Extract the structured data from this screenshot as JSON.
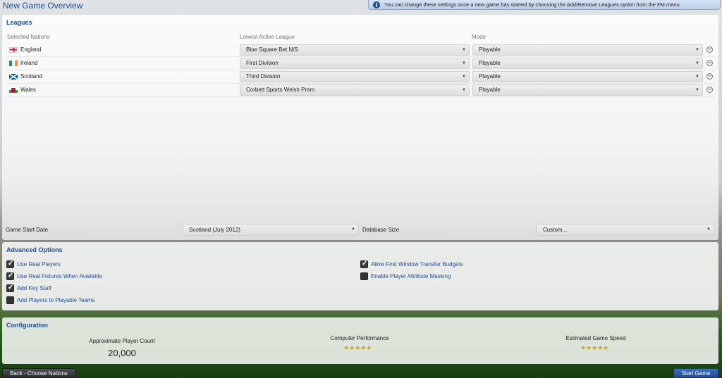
{
  "header": {
    "title": "New Game Overview",
    "info": "You can change these settings once a new game has started by choosing the Add/Remove Leagues option from the FM menu."
  },
  "leagues": {
    "title": "Leagues",
    "columns": {
      "nations": "Selected Nations",
      "league": "Lowest Active League",
      "mode": "Mode"
    },
    "rows": [
      {
        "nation": "England",
        "flag": "england",
        "league": "Blue Square Bet N/S",
        "mode": "Playable"
      },
      {
        "nation": "Ireland",
        "flag": "ireland",
        "league": "First Division",
        "mode": "Playable"
      },
      {
        "nation": "Scotland",
        "flag": "scotland",
        "league": "Third Division",
        "mode": "Playable"
      },
      {
        "nation": "Wales",
        "flag": "wales",
        "league": "Corbett Sports Welsh Prem",
        "mode": "Playable"
      }
    ],
    "game_start_date_label": "Game Start Date",
    "game_start_date_value": "Scotland (July 2012)",
    "database_size_label": "Database Size",
    "database_size_value": "Custom..."
  },
  "advanced": {
    "title": "Advanced Options",
    "options": [
      {
        "label": "Use Real Players",
        "checked": true
      },
      {
        "label": "Use Real Fixtures When Available",
        "checked": true
      },
      {
        "label": "Add Key Staff",
        "checked": true
      },
      {
        "label": "Add Players to Playable Teams",
        "checked": false
      },
      {
        "label": "Allow First Window Transfer Budgets",
        "checked": true
      },
      {
        "label": "Enable Player Attribute Masking",
        "checked": false
      }
    ]
  },
  "configuration": {
    "title": "Configuration",
    "player_count_label": "Approximate Player Count",
    "player_count_value": "20,000",
    "computer_performance_label": "Computer Performance",
    "computer_performance_stars": 5,
    "game_speed_label": "Estimated Game Speed",
    "game_speed_stars": 5
  },
  "footer": {
    "back_label": "Back - Choose Nations",
    "start_label": "Start Game"
  },
  "colors": {
    "accent": "#1f4d94",
    "star": "#d9a300"
  }
}
